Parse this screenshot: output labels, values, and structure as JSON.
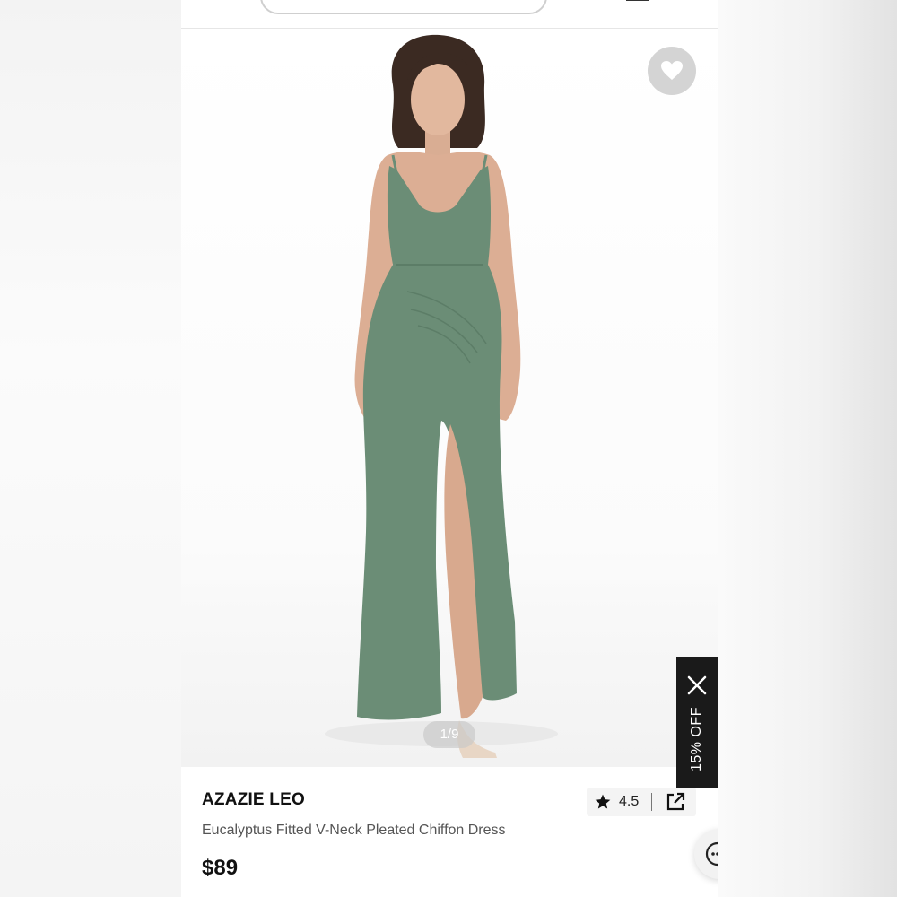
{
  "header": {
    "search_pill": "search-bar",
    "menu_icon": "menu-icon"
  },
  "product": {
    "image_counter": "1/9",
    "brand": "AZAZIE LEO",
    "title": "Eucalyptus Fitted V-Neck Pleated Chiffon Dress",
    "price": "$89",
    "rating": "4.5",
    "dress_color": "#6b8d76"
  },
  "promo": {
    "label": "15% OFF"
  },
  "icons": {
    "favorite": "heart-icon",
    "close": "close-icon",
    "star": "star-icon",
    "share": "share-icon",
    "chat": "chat-icon"
  },
  "colors": {
    "favorite_button": "#d4d4d4",
    "promo_background": "#1a1a1a",
    "text_primary": "#111111",
    "text_secondary": "#555555"
  }
}
